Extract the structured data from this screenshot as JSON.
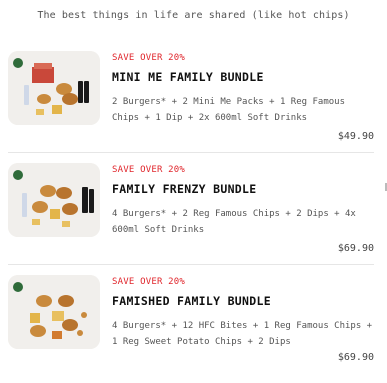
{
  "tagline": "The best things in life are shared (like hot chips)",
  "bundles": [
    {
      "promo": "SAVE OVER 20%",
      "title": "MINI ME FAMILY BUNDLE",
      "description": "2 Burgers* + 2 Mini Me Packs + 1 Reg Famous Chips + 1 Dip + 2x 600ml Soft Drinks",
      "price": "$49.90"
    },
    {
      "promo": "SAVE OVER 20%",
      "title": "FAMILY FRENZY BUNDLE",
      "description": "4 Burgers* + 2 Reg Famous Chips + 2 Dips + 4x 600ml Soft Drinks",
      "price": "$69.90"
    },
    {
      "promo": "SAVE OVER 20%",
      "title": "FAMISHED FAMILY BUNDLE",
      "description": "4 Burgers* + 12 HFC Bites + 1 Reg Famous Chips + 1 Reg Sweet Potato Chips + 2 Dips",
      "price": "$69.90"
    }
  ],
  "colors": {
    "promo": "#e0262c",
    "badge": "#2f6b3a",
    "thumb_bg": "#f1efec"
  }
}
